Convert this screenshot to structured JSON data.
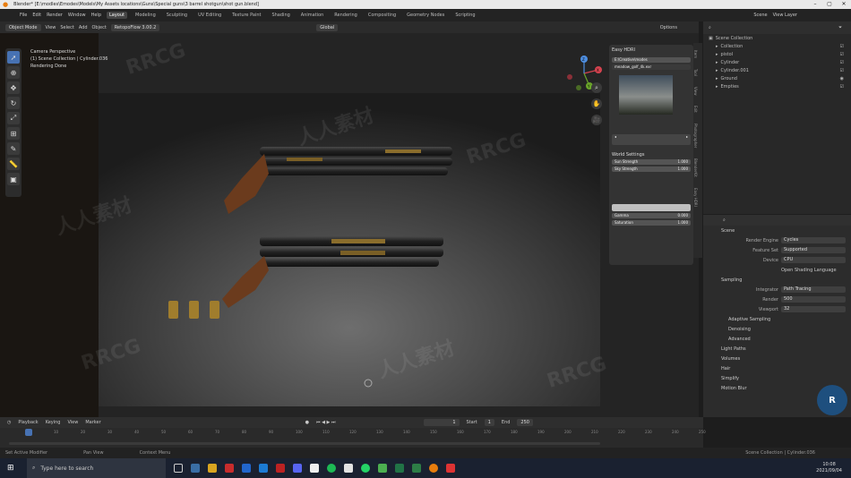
{
  "titlebar": {
    "title": "Blender* [E:\\modles\\Emodes\\Models\\My Assets locations\\Guns\\Special guns\\3 barrel shotgun\\shot gun.blend]"
  },
  "menubar": {
    "menus": [
      "File",
      "Edit",
      "Render",
      "Window",
      "Help"
    ],
    "workspaces": [
      "Layout",
      "Modeling",
      "Sculpting",
      "UV Editing",
      "Texture Paint",
      "Shading",
      "Animation",
      "Rendering",
      "Compositing",
      "Geometry Nodes",
      "Scripting"
    ],
    "scene": "Scene",
    "view_layer": "View Layer"
  },
  "viewport": {
    "mode": "Object Mode",
    "menus": [
      "View",
      "Select",
      "Add",
      "Object"
    ],
    "addon_label": "RetopoFlow 3.00.2",
    "transform": "Global",
    "options": "Options",
    "overlay_lines": [
      "Camera Perspective",
      "(1) Scene Collection | Cylinder.036",
      "Rendering Done"
    ],
    "gizmo_axes": [
      "X",
      "Y",
      "Z"
    ]
  },
  "easy_hdri": {
    "title": "Easy HDRI",
    "path": "E:\\Creative\\modes",
    "file": "meadow_golf_4k.exr",
    "world_settings": "World Settings",
    "fields": [
      {
        "label": "Sun Strength",
        "value": "1.000"
      },
      {
        "label": "Sky Strength",
        "value": "1.000"
      },
      {
        "label": "Gamma",
        "value": "0.000"
      },
      {
        "label": "Saturation",
        "value": "1.000"
      }
    ]
  },
  "vertical_tabs": [
    "Item",
    "Tool",
    "View",
    "Edit",
    "Photographer",
    "BlenderKit",
    "Easy HDRI"
  ],
  "outliner": {
    "header": "Scene Collection",
    "rows": [
      "Collection",
      "pistol",
      "Cylinder",
      "Cylinder.001",
      "Ground",
      "Empties"
    ]
  },
  "properties": {
    "scene_label": "Scene",
    "rows": [
      {
        "label": "Render Engine",
        "value": "Cycles"
      },
      {
        "label": "Feature Set",
        "value": "Supported"
      },
      {
        "label": "Device",
        "value": "CPU"
      }
    ],
    "osl": "Open Shading Language",
    "sampling": "Sampling",
    "integrator_label": "Integrator",
    "integrator": "Path Tracing",
    "render_label": "Render",
    "render_value": "500",
    "viewport_label": "Viewport",
    "viewport_value": "32",
    "subsections": [
      "Adaptive Sampling",
      "Denoising",
      "Advanced"
    ],
    "sections": [
      "Light Paths",
      "Volumes",
      "Hair",
      "Simplify",
      "Motion Blur"
    ]
  },
  "timeline": {
    "menus": [
      "Playback",
      "Keying",
      "View",
      "Marker"
    ],
    "current_frame": "1",
    "start_label": "Start",
    "start": "1",
    "end_label": "End",
    "end": "250",
    "ticks": [
      "0",
      "10",
      "20",
      "30",
      "40",
      "50",
      "60",
      "70",
      "80",
      "90",
      "100",
      "110",
      "120",
      "130",
      "140",
      "150",
      "160",
      "170",
      "180",
      "190",
      "200",
      "210",
      "220",
      "230",
      "240",
      "250"
    ]
  },
  "statusbar": {
    "items": [
      "Set Active Modifier",
      "Pan View",
      "Context Menu"
    ],
    "right": "Scene Collection | Cylinder.036"
  },
  "taskbar": {
    "search_placeholder": "Type here to search",
    "time": "10:08",
    "date": "2021/09/04"
  },
  "watermark": {
    "brand": "RRCG",
    "cn": "人人素材"
  },
  "colors": {
    "accent": "#4772b3",
    "bg": "#1d1d1d"
  }
}
